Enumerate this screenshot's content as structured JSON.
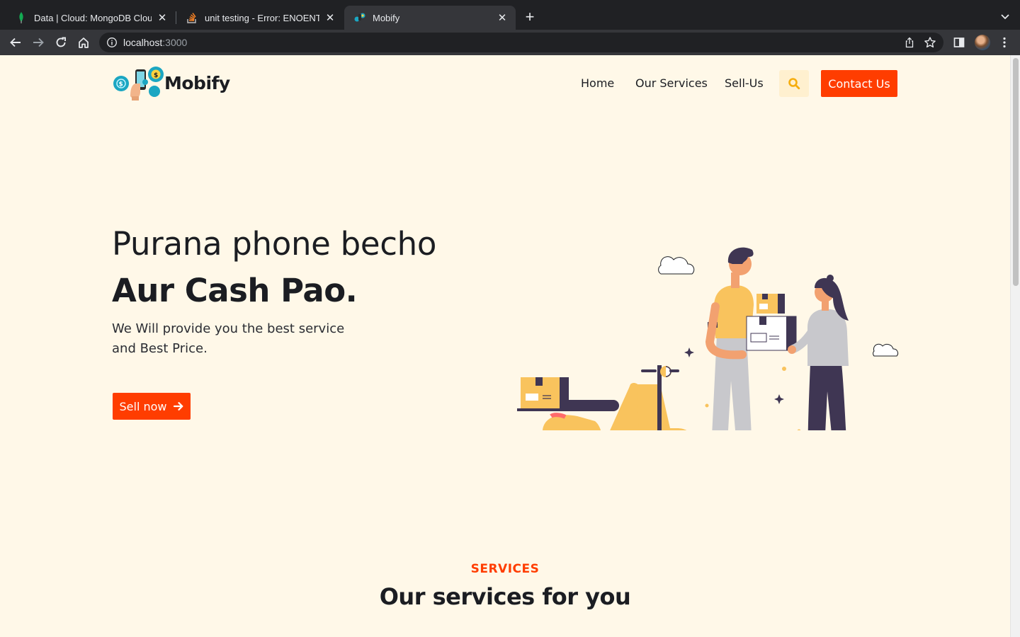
{
  "browser": {
    "tabs": [
      {
        "title": "Data | Cloud: MongoDB Cloud",
        "favicon": "mongodb-leaf-icon",
        "active": false
      },
      {
        "title": "unit testing - Error: ENOENT: n",
        "favicon": "stackoverflow-icon",
        "active": false
      },
      {
        "title": "Mobify",
        "favicon": "mobify-icon",
        "active": true
      }
    ],
    "url_host": "localhost",
    "url_port": ":3000"
  },
  "site": {
    "logo_text": "Mobify",
    "nav": [
      "Home",
      "Our Services",
      "Sell-Us"
    ],
    "contact_label": "Contact Us",
    "accent_color": "#ff3d00",
    "background_color": "#fff8e8"
  },
  "hero": {
    "line1": "Purana phone becho",
    "line2": "Aur Cash Pao.",
    "desc_line1": "We Will provide you the best service",
    "desc_line2": "and Best Price.",
    "cta_label": "Sell now"
  },
  "services": {
    "kicker": "SERVICES",
    "title": "Our services for you"
  }
}
